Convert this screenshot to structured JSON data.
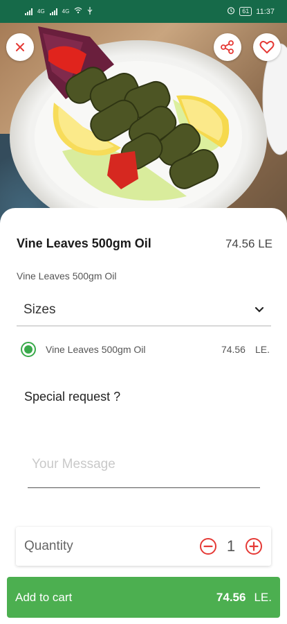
{
  "status_bar": {
    "time": "11:37",
    "battery": "61",
    "network_1": "4G",
    "network_2": "4G"
  },
  "header": {
    "close_icon": "close-icon",
    "share_icon": "share-icon",
    "favorite_icon": "heart-icon"
  },
  "product": {
    "name": "Vine Leaves 500gm Oil",
    "price": "74.56 LE",
    "description": "Vine Leaves 500gm Oil"
  },
  "sizes": {
    "title": "Sizes",
    "options": [
      {
        "label": "Vine Leaves 500gm Oil",
        "price": "74.56",
        "currency": "LE.",
        "selected": true
      }
    ]
  },
  "special_request": {
    "label": "Special request ?",
    "placeholder": "Your Message",
    "value": ""
  },
  "quantity": {
    "label": "Quantity",
    "value": "1"
  },
  "cart": {
    "label": "Add to cart",
    "price": "74.56",
    "currency": "LE."
  },
  "colors": {
    "status_bar": "#166a49",
    "accent_green": "#4caf50",
    "radio_green": "#3aaa4b",
    "icon_red": "#e53935"
  }
}
